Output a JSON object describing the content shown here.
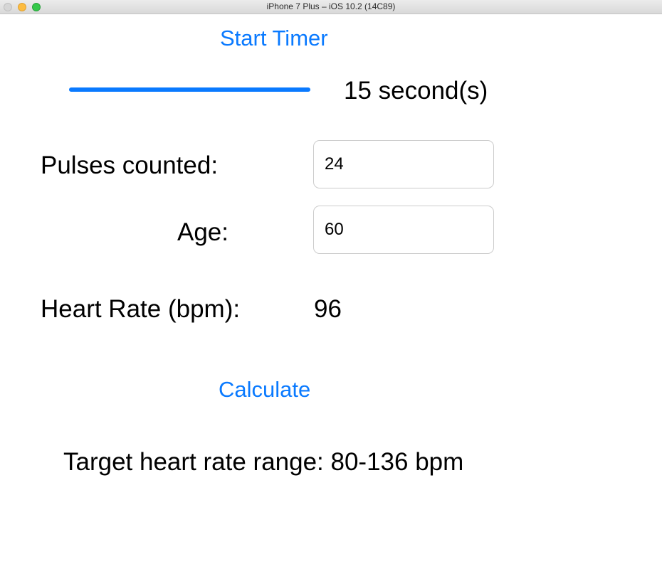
{
  "window": {
    "title": "iPhone 7 Plus – iOS 10.2 (14C89)"
  },
  "timer": {
    "start_label": "Start Timer",
    "value_label": "15 second(s)",
    "slider_level": 1.0
  },
  "form": {
    "pulses_label": "Pulses counted:",
    "pulses_value": "24",
    "age_label": "Age:",
    "age_value": "60"
  },
  "result": {
    "heart_rate_label": "Heart Rate (bpm):",
    "heart_rate_value": "96",
    "calculate_label": "Calculate",
    "target_text": "Target heart rate range: 80-136 bpm"
  },
  "colors": {
    "accent": "#0a7aff",
    "text": "#000000"
  },
  "icons": {
    "close": "traffic-light-close-icon",
    "minimize": "traffic-light-minimize-icon",
    "maximize": "traffic-light-maximize-icon"
  }
}
